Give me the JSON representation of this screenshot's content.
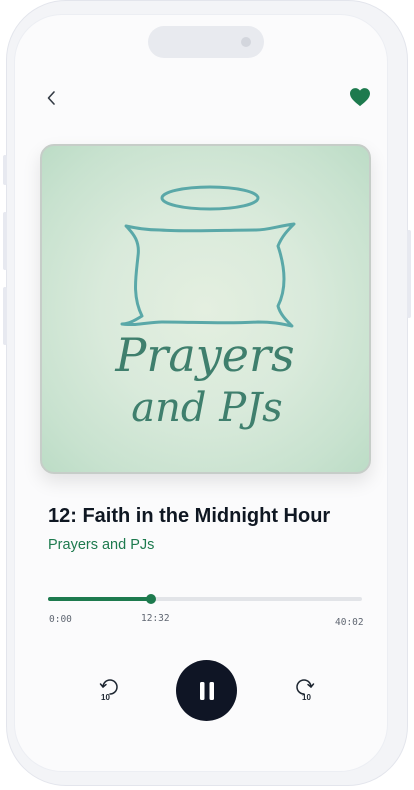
{
  "episode": {
    "title": "12: Faith in the Midnight Hour",
    "show": "Prayers and PJs"
  },
  "artwork": {
    "line1": "Prayers",
    "line2": "and PJs"
  },
  "player": {
    "elapsed": "0:00",
    "current": "12:32",
    "duration": "40:02",
    "progress_fraction": 0.3285,
    "skip_back_seconds": "10",
    "skip_forward_seconds": "10",
    "state": "playing"
  },
  "icons": {
    "back": "chevron-left-icon",
    "favorite": "heart-icon",
    "skip_back": "rewind-10-icon",
    "skip_forward": "forward-10-icon",
    "pause": "pause-icon"
  },
  "colors": {
    "accent": "#1d7a4e",
    "play_button": "#0f1525",
    "artwork_ink": "#3f7f6d",
    "artwork_outline": "#5aa8a8"
  }
}
